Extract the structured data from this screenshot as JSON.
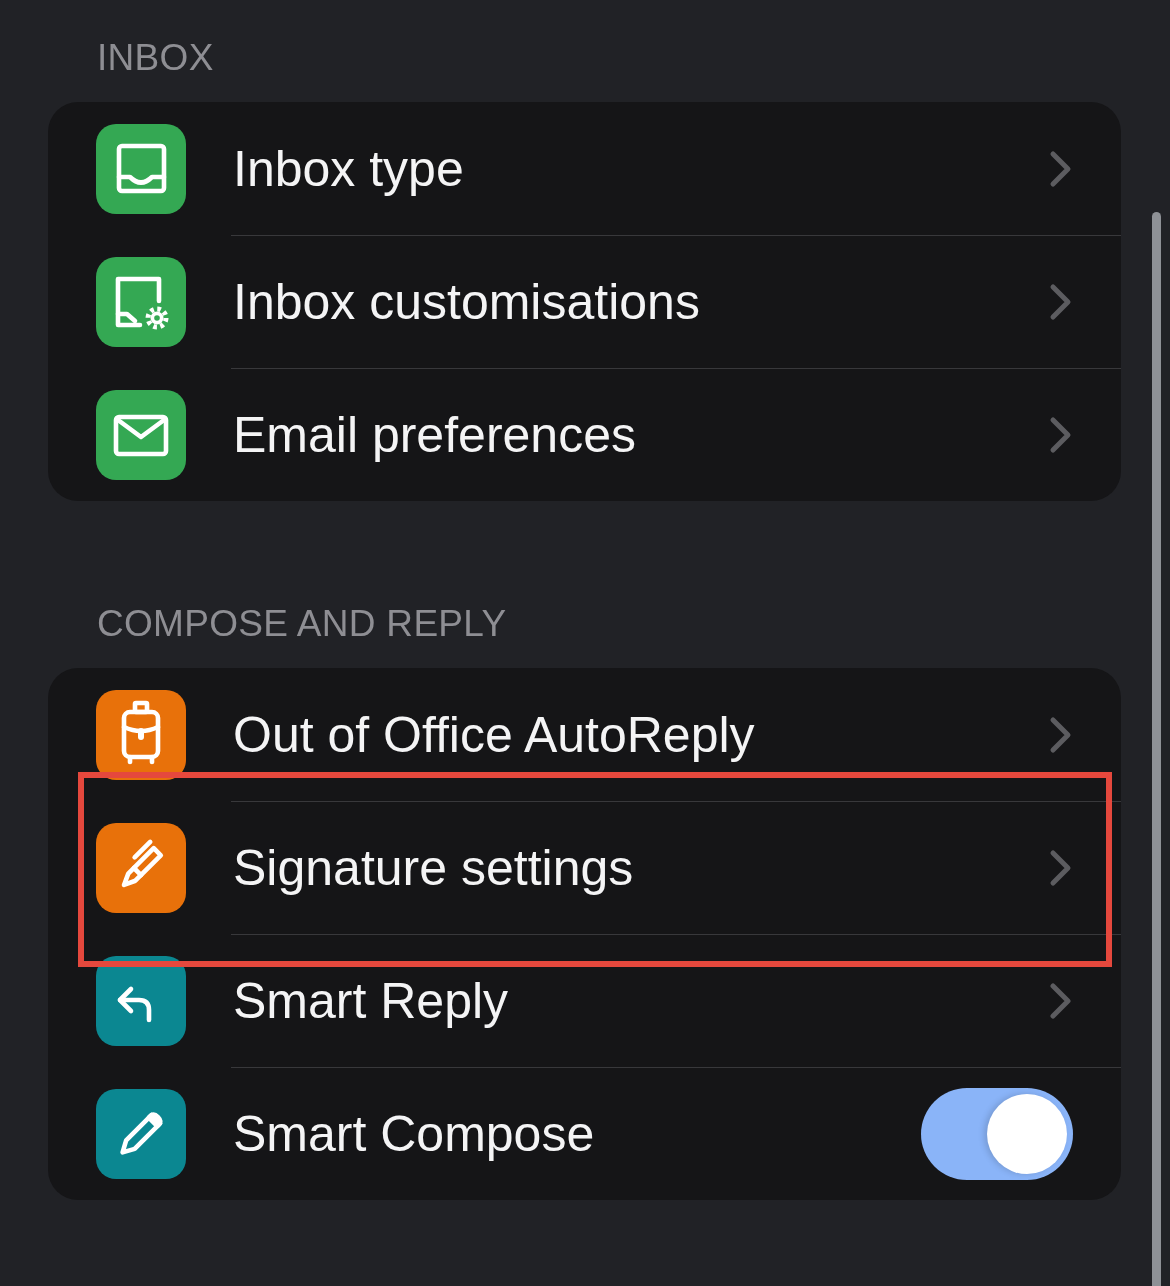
{
  "sections": [
    {
      "title": "INBOX",
      "items": [
        {
          "kind": "link",
          "label": "Inbox type",
          "color": "#34a853",
          "highlighted": false
        },
        {
          "kind": "link",
          "label": "Inbox customisations",
          "color": "#34a853",
          "highlighted": false
        },
        {
          "kind": "link",
          "label": "Email preferences",
          "color": "#34a853",
          "highlighted": false
        }
      ]
    },
    {
      "title": "COMPOSE AND REPLY",
      "items": [
        {
          "kind": "link",
          "label": "Out of Office AutoReply",
          "color": "#e8710a",
          "highlighted": false
        },
        {
          "kind": "link",
          "label": "Signature settings",
          "color": "#e8710a",
          "highlighted": true
        },
        {
          "kind": "link",
          "label": "Smart Reply",
          "color": "#0b8791",
          "highlighted": false
        },
        {
          "kind": "toggle",
          "label": "Smart Compose",
          "color": "#0b8791",
          "highlighted": false,
          "on": true
        }
      ]
    }
  ]
}
